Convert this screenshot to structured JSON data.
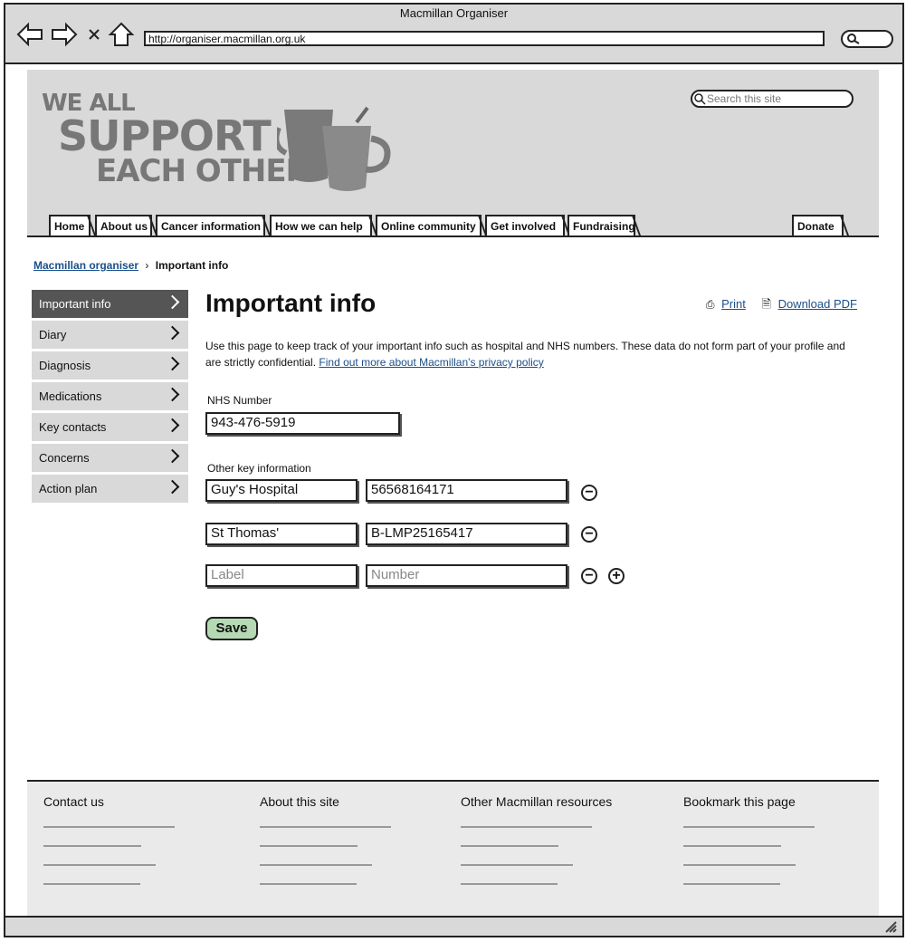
{
  "browser": {
    "title": "Macmillan Organiser",
    "url": "http://organiser.macmillan.org.uk"
  },
  "header": {
    "logo_lines": [
      "WE ALL",
      "SUPPORT",
      "EACH OTHER"
    ],
    "search_placeholder": "Search this site",
    "tabs": [
      "Home",
      "About us",
      "Cancer information",
      "How we can help",
      "Online community",
      "Get involved",
      "Fundraising"
    ],
    "donate": "Donate"
  },
  "breadcrumb": {
    "parent": "Macmillan organiser",
    "current": "Important info"
  },
  "sidebar": {
    "items": [
      "Important info",
      "Diary",
      "Diagnosis",
      "Medications",
      "Key contacts",
      "Concerns",
      "Action plan"
    ]
  },
  "main": {
    "title": "Important info",
    "print": "Print",
    "download": "Download PDF",
    "intro": "Use this page to keep track of your important info such as hospital and NHS numbers. These data do not form part of your profile and are strictly confidential.",
    "privacy_link": "Find out more about Macmillan's privacy policy",
    "nhs_label": "NHS Number",
    "nhs_value": "943-476-5919",
    "other_label": "Other key information",
    "rows": [
      {
        "label": "Guy's Hospital",
        "number": "56568164171"
      },
      {
        "label": "St Thomas'",
        "number": "B-LMP25165417"
      }
    ],
    "new_label_placeholder": "Label",
    "new_number_placeholder": "Number",
    "save": "Save"
  },
  "footer": {
    "columns": [
      "Contact us",
      "About this site",
      "Other Macmillan resources",
      "Bookmark this page"
    ]
  },
  "colors": {
    "link": "#1a4f8a",
    "header_bg": "#d9d9d9",
    "active_nav": "#555555",
    "save_button": "#b5dab3"
  }
}
